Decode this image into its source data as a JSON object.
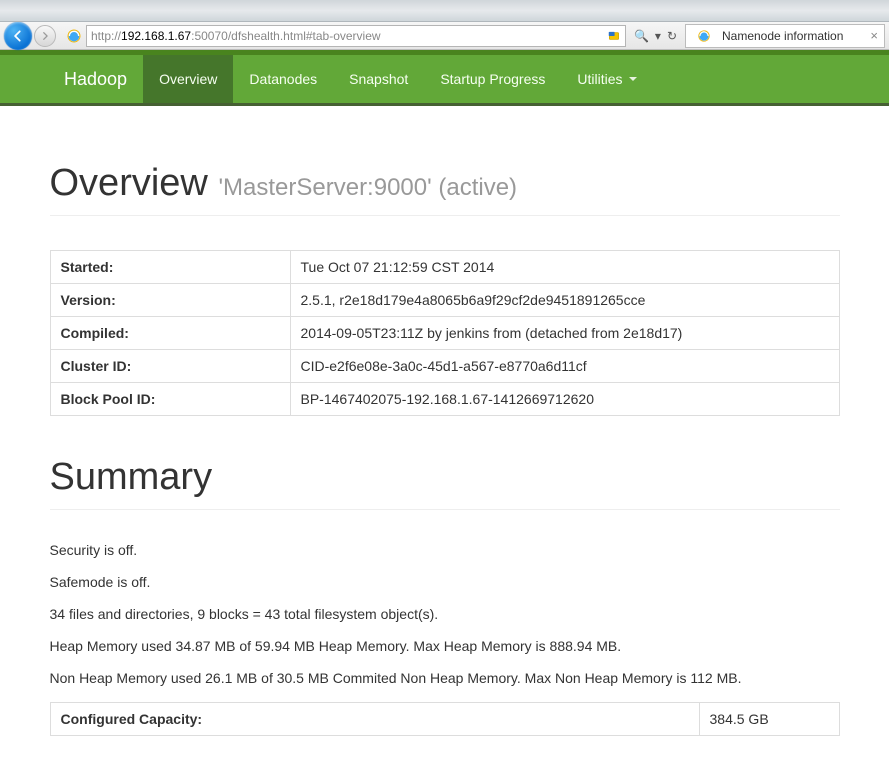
{
  "browser": {
    "url_prefix": "http://",
    "url_host": "192.168.1.67",
    "url_rest": ":50070/dfshealth.html#tab-overview",
    "search_glyph": "🔍",
    "tab_title": "Namenode information",
    "close_glyph": "×",
    "refresh_glyph": "↻",
    "dropdown_glyph": "▾"
  },
  "nav": {
    "brand": "Hadoop",
    "items": [
      {
        "label": "Overview"
      },
      {
        "label": "Datanodes"
      },
      {
        "label": "Snapshot"
      },
      {
        "label": "Startup Progress"
      },
      {
        "label": "Utilities"
      }
    ]
  },
  "overview": {
    "heading": "Overview",
    "sub": "'MasterServer:9000' (active)",
    "rows": [
      {
        "k": "Started:",
        "v": "Tue Oct 07 21:12:59 CST 2014"
      },
      {
        "k": "Version:",
        "v": "2.5.1, r2e18d179e4a8065b6a9f29cf2de9451891265cce"
      },
      {
        "k": "Compiled:",
        "v": "2014-09-05T23:11Z by jenkins from (detached from 2e18d17)"
      },
      {
        "k": "Cluster ID:",
        "v": "CID-e2f6e08e-3a0c-45d1-a567-e8770a6d11cf"
      },
      {
        "k": "Block Pool ID:",
        "v": "BP-1467402075-192.168.1.67-1412669712620"
      }
    ]
  },
  "summary": {
    "heading": "Summary",
    "lines": [
      "Security is off.",
      "Safemode is off.",
      "34 files and directories, 9 blocks = 43 total filesystem object(s).",
      "Heap Memory used 34.87 MB of 59.94 MB Heap Memory. Max Heap Memory is 888.94 MB.",
      "Non Heap Memory used 26.1 MB of 30.5 MB Commited Non Heap Memory. Max Non Heap Memory is 112 MB."
    ],
    "capacity": {
      "k": "Configured Capacity:",
      "v": "384.5 GB"
    }
  }
}
